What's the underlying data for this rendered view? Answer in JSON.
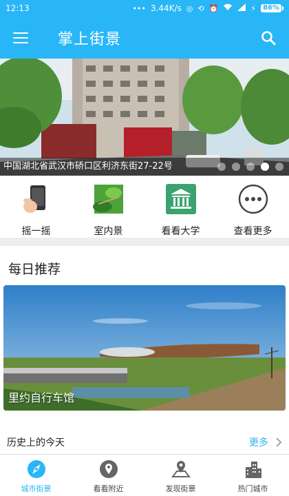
{
  "status_bar": {
    "time": "12:13",
    "network_speed": "3.44K/s",
    "battery": "86%"
  },
  "header": {
    "title": "掌上街景"
  },
  "banner": {
    "caption": "中国湖北省武汉市硚口区利济东街27-22号",
    "slides": 5,
    "active_slide": 3
  },
  "quick_actions": [
    {
      "label": "摇一摇",
      "icon": "phone-shake-icon"
    },
    {
      "label": "室内景",
      "icon": "indoor-scene-icon"
    },
    {
      "label": "看看大学",
      "icon": "university-icon"
    },
    {
      "label": "查看更多",
      "icon": "more-dots-icon"
    }
  ],
  "daily": {
    "title": "每日推荐",
    "feature_label": "里约自行车馆"
  },
  "history": {
    "title": "历史上的今天",
    "more": "更多"
  },
  "bottom_nav": [
    {
      "label": "城市街景",
      "icon": "compass-icon",
      "active": true
    },
    {
      "label": "看看附近",
      "icon": "location-pin-icon",
      "active": false
    },
    {
      "label": "发现街景",
      "icon": "map-pin-icon",
      "active": false
    },
    {
      "label": "热门城市",
      "icon": "city-buildings-icon",
      "active": false
    }
  ],
  "colors": {
    "primary": "#29b6f6",
    "accent_green": "#3aa36f",
    "separator": "#eeeeee"
  }
}
